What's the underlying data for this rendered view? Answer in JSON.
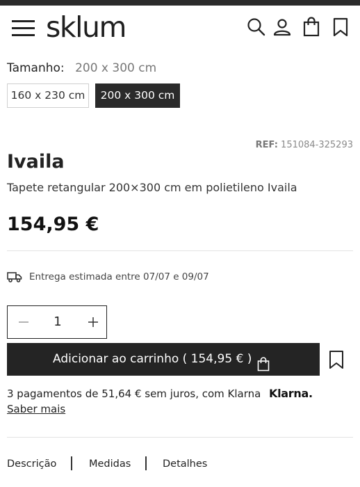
{
  "header": {
    "logo": "sklum",
    "icons": [
      "menu-icon",
      "search-icon",
      "user-icon",
      "bag-icon",
      "bookmark-icon"
    ]
  },
  "size": {
    "label": "Tamanho:",
    "selected": "200 x 300 cm",
    "options": [
      "160 x 230 cm",
      "200 x 300 cm"
    ]
  },
  "product": {
    "ref_label": "REF:",
    "ref_value": "151084-325293",
    "title": "Ivaila",
    "subtitle": "Tapete retangular 200×300 cm em polietileno Ivaila",
    "price": "154,95 €"
  },
  "delivery": {
    "icon": "truck-icon",
    "text": "Entrega estimada entre 07/07 e 09/07"
  },
  "quantity": {
    "value": "1"
  },
  "cart": {
    "button_label": "Adicionar ao carrinho ( 154,95 € )",
    "icon": "bag-icon"
  },
  "financing": {
    "text": "3 pagamentos de 51,64 € sem juros, com Klarna",
    "brand": "Klarna.",
    "link": "Saber mais"
  },
  "tabs": [
    "Descrição",
    "Medidas",
    "Detalhes"
  ],
  "colors": {
    "primary": "#242424",
    "text": "#222222",
    "muted": "#8a8a8a",
    "border": "#cfcfcf"
  }
}
